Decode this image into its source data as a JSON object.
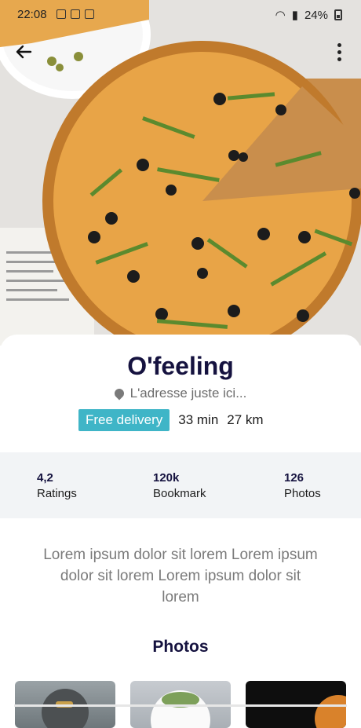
{
  "status_bar": {
    "time": "22:08",
    "battery": "24%"
  },
  "restaurant": {
    "name": "O'feeling",
    "address": "L'adresse juste ici...",
    "badge": "Free delivery",
    "time": "33 min",
    "distance": "27 km"
  },
  "stats": [
    {
      "value": "4,2",
      "label": "Ratings"
    },
    {
      "value": "120k",
      "label": "Bookmark"
    },
    {
      "value": "126",
      "label": "Photos"
    }
  ],
  "description": "Lorem ipsum dolor sit lorem Lorem ipsum dolor sit lorem Lorem ipsum dolor sit lorem",
  "photos_title": "Photos",
  "colors": {
    "badge": "#3fb5c7",
    "title": "#15123f"
  }
}
